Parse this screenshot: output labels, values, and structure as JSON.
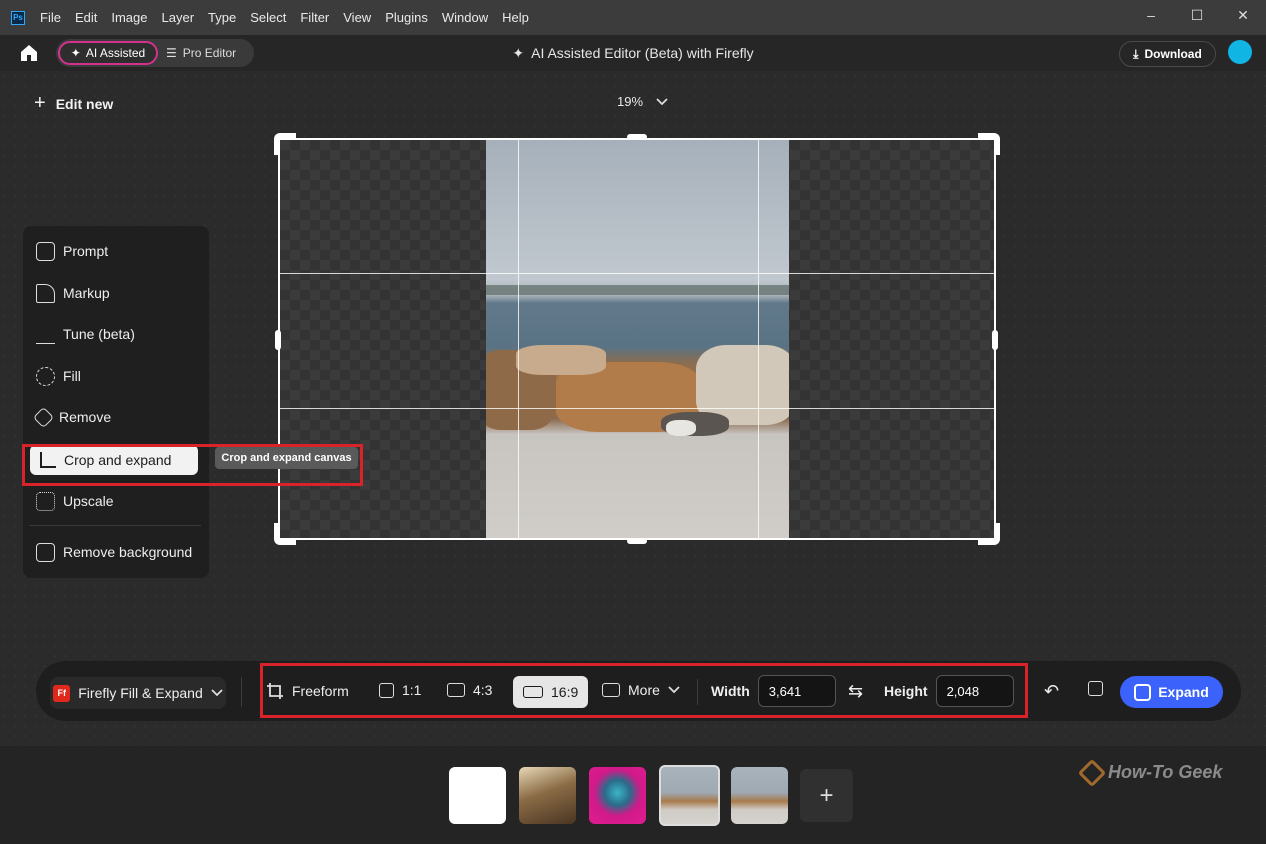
{
  "titlebar": {
    "app_icon": "Ps",
    "menu": [
      "File",
      "Edit",
      "Image",
      "Layer",
      "Type",
      "Select",
      "Filter",
      "View",
      "Plugins",
      "Window",
      "Help"
    ],
    "controls": [
      "minimize-icon",
      "maximize-icon",
      "close-icon"
    ]
  },
  "header": {
    "mode_ai": "AI Assisted",
    "mode_pro": "Pro Editor",
    "title": "AI Assisted Editor (Beta) with Firefly",
    "download": "Download"
  },
  "workspace": {
    "edit_new": "Edit new",
    "zoom": "19%"
  },
  "tools": {
    "items": [
      {
        "label": "Prompt",
        "icon": "prompt-icon"
      },
      {
        "label": "Markup",
        "icon": "markup-icon"
      },
      {
        "label": "Tune (beta)",
        "icon": "tune-icon"
      },
      {
        "label": "Fill",
        "icon": "fill-icon"
      },
      {
        "label": "Remove",
        "icon": "remove-icon"
      },
      {
        "label": "Crop and expand",
        "icon": "crop-icon",
        "active": true
      },
      {
        "label": "Upscale",
        "icon": "upscale-icon"
      },
      {
        "label": "Remove background",
        "icon": "remove-background-icon"
      }
    ],
    "tooltip": "Crop and expand canvas"
  },
  "toolbar": {
    "mode": "Firefly Fill & Expand",
    "mode_logo": "Ff",
    "ratios": {
      "freeform": "Freeform",
      "r11": "1:1",
      "r43": "4:3",
      "r169": "16:9",
      "more": "More"
    },
    "active_ratio": "16:9",
    "width_label": "Width",
    "width_value": "3,641",
    "height_label": "Height",
    "height_value": "2,048",
    "expand": "Expand"
  },
  "filmstrip": {
    "add": "+",
    "watermark": "How-To Geek"
  },
  "colors": {
    "accent": "#3b63fb",
    "highlight_box": "#d9232a",
    "ai_border": "#d4318f"
  }
}
